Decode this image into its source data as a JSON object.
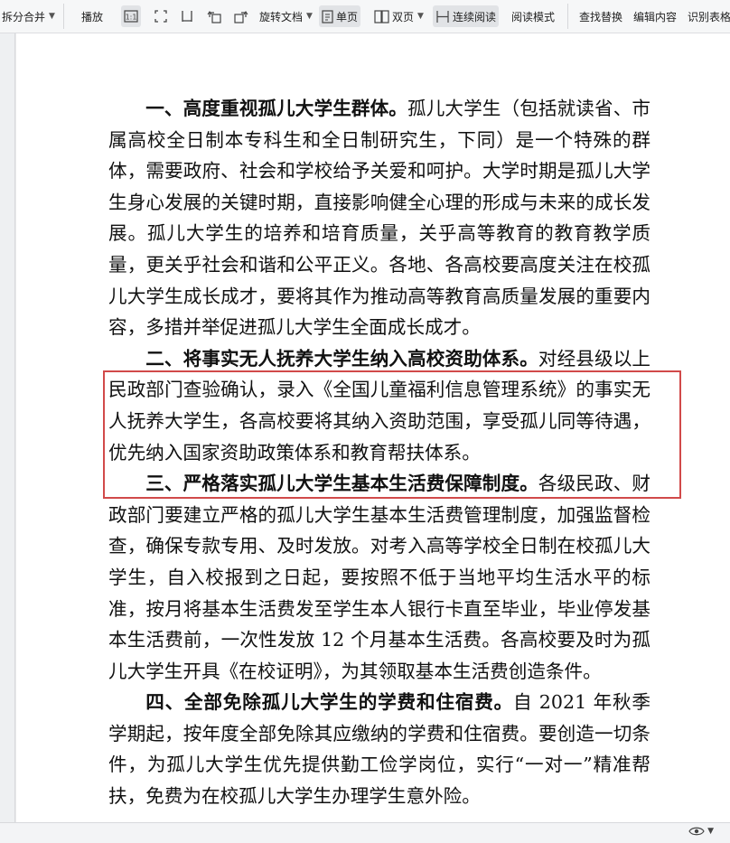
{
  "toolbar": {
    "split_merge": "拆分合并",
    "play": "播放",
    "rotate_doc": "旋转文档",
    "single_page": "单页",
    "double_page": "双页",
    "continuous_read": "连续阅读",
    "read_mode": "阅读模式",
    "find_replace": "查找替换",
    "edit_content": "编辑内容",
    "ocr_table": "识别表格"
  },
  "document": {
    "para1_heading": "一、高度重视孤儿大学生群体。",
    "para1_body": "孤儿大学生（包括就读省、市属高校全日制本专科生和全日制研究生，下同）是一个特殊的群体，需要政府、社会和学校给予关爱和呵护。大学时期是孤儿大学生身心发展的关键时期，直接影响健全心理的形成与未来的成长发展。孤儿大学生的培养和培育质量，关乎高等教育的教育教学质量，更关乎社会和谐和公平正义。各地、各高校要高度关注在校孤儿大学生成长成才，要将其作为推动高等教育高质量发展的重要内容，多措并举促进孤儿大学生全面成长成才。",
    "para2_heading": "二、将事实无人抚养大学生纳入高校资助体系。",
    "para2_body": "对经县级以上民政部门查验确认，录入《全国儿童福利信息管理系统》的事实无人抚养大学生，各高校要将其纳入资助范围，享受孤儿同等待遇，优先纳入国家资助政策体系和教育帮扶体系。",
    "para3_heading": "三、严格落实孤儿大学生基本生活费保障制度。",
    "para3_body": "各级民政、财政部门要建立严格的孤儿大学生基本生活费管理制度，加强监督检查，确保专款专用、及时发放。对考入高等学校全日制在校孤儿大学生，自入校报到之日起，要按照不低于当地平均生活水平的标准，按月将基本生活费发至学生本人银行卡直至毕业，毕业停发基本生活费前，一次性发放 12 个月基本生活费。各高校要及时为孤儿大学生开具《在校证明》，为其领取基本生活费创造条件。",
    "para4_heading": "四、全部免除孤儿大学生的学费和住宿费。",
    "para4_body": "自 2021 年秋季学期起，按年度全部免除其应缴纳的学费和住宿费。要创造一切条件，为孤儿大学生优先提供勤工俭学岗位，实行“一对一”精准帮扶，免费为在校孤儿大学生办理学生意外险。"
  },
  "icons": [
    "chevron-down-icon",
    "fit-page-icon",
    "fit-width-icon",
    "actual-size-icon",
    "rotate-left-icon",
    "rotate-right-icon",
    "single-page-icon",
    "double-page-icon",
    "continuous-icon",
    "eye-icon"
  ],
  "colors": {
    "highlight_border": "#d14a4a",
    "toolbar_bg": "#f6f7f8",
    "active_button_bg": "#e1e3e6"
  }
}
